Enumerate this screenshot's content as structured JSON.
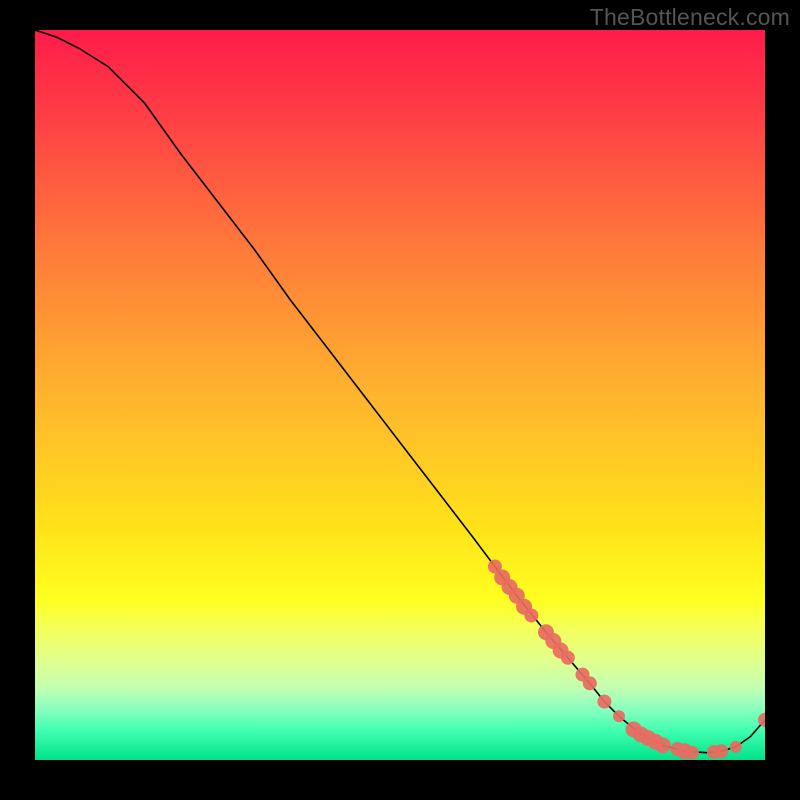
{
  "watermark": "TheBottleneck.com",
  "chart_data": {
    "type": "line",
    "title": "",
    "xlabel": "",
    "ylabel": "",
    "xlim": [
      0,
      100
    ],
    "ylim": [
      0,
      100
    ],
    "gradient_stops": [
      {
        "pos": 0,
        "color": "#ff1b4a"
      },
      {
        "pos": 0.12,
        "color": "#ff3f45"
      },
      {
        "pos": 0.3,
        "color": "#ff7a3a"
      },
      {
        "pos": 0.5,
        "color": "#ffb42e"
      },
      {
        "pos": 0.68,
        "color": "#ffe21a"
      },
      {
        "pos": 0.78,
        "color": "#ffff20"
      },
      {
        "pos": 0.82,
        "color": "#f4ff5a"
      },
      {
        "pos": 0.86,
        "color": "#e4ff8a"
      },
      {
        "pos": 0.9,
        "color": "#c4ffb0"
      },
      {
        "pos": 0.93,
        "color": "#8affc0"
      },
      {
        "pos": 0.96,
        "color": "#40ffb0"
      },
      {
        "pos": 1.0,
        "color": "#00e28a"
      }
    ],
    "series": [
      {
        "name": "bottleneck-curve",
        "color": "#000000",
        "x": [
          0,
          3,
          6,
          10,
          15,
          20,
          25,
          30,
          35,
          40,
          45,
          50,
          55,
          60,
          63,
          66,
          70,
          73,
          76,
          78,
          80,
          83,
          86,
          89,
          92,
          94,
          96,
          98,
          100
        ],
        "y": [
          100,
          99,
          97.5,
          95,
          90,
          83,
          76.5,
          70,
          63,
          56.5,
          50,
          43.5,
          37,
          30.5,
          26.5,
          22.5,
          17.5,
          14,
          10.5,
          8,
          6,
          3.5,
          2,
          1.2,
          1,
          1.2,
          1.8,
          3.2,
          5.5
        ]
      }
    ],
    "markers": {
      "name": "highlighted-points",
      "color": "#e86b61",
      "points": [
        {
          "x": 63,
          "y": 26.5,
          "r": 7
        },
        {
          "x": 64,
          "y": 25,
          "r": 8
        },
        {
          "x": 65,
          "y": 23.7,
          "r": 8
        },
        {
          "x": 66,
          "y": 22.5,
          "r": 8
        },
        {
          "x": 67,
          "y": 21,
          "r": 8
        },
        {
          "x": 68,
          "y": 19.8,
          "r": 7
        },
        {
          "x": 70,
          "y": 17.5,
          "r": 8
        },
        {
          "x": 71,
          "y": 16.3,
          "r": 8
        },
        {
          "x": 72,
          "y": 15,
          "r": 8
        },
        {
          "x": 73,
          "y": 14,
          "r": 7
        },
        {
          "x": 75,
          "y": 11.7,
          "r": 7
        },
        {
          "x": 76,
          "y": 10.5,
          "r": 7
        },
        {
          "x": 78,
          "y": 8,
          "r": 7
        },
        {
          "x": 80,
          "y": 6,
          "r": 6
        },
        {
          "x": 82,
          "y": 4.2,
          "r": 8
        },
        {
          "x": 83,
          "y": 3.5,
          "r": 8
        },
        {
          "x": 84,
          "y": 3.0,
          "r": 8
        },
        {
          "x": 85,
          "y": 2.5,
          "r": 8
        },
        {
          "x": 86,
          "y": 2.0,
          "r": 8
        },
        {
          "x": 88,
          "y": 1.5,
          "r": 7
        },
        {
          "x": 89,
          "y": 1.2,
          "r": 8
        },
        {
          "x": 90,
          "y": 1.0,
          "r": 7
        },
        {
          "x": 93,
          "y": 1.1,
          "r": 7
        },
        {
          "x": 94,
          "y": 1.2,
          "r": 7
        },
        {
          "x": 96,
          "y": 1.8,
          "r": 6
        },
        {
          "x": 100,
          "y": 5.5,
          "r": 7
        }
      ]
    }
  }
}
